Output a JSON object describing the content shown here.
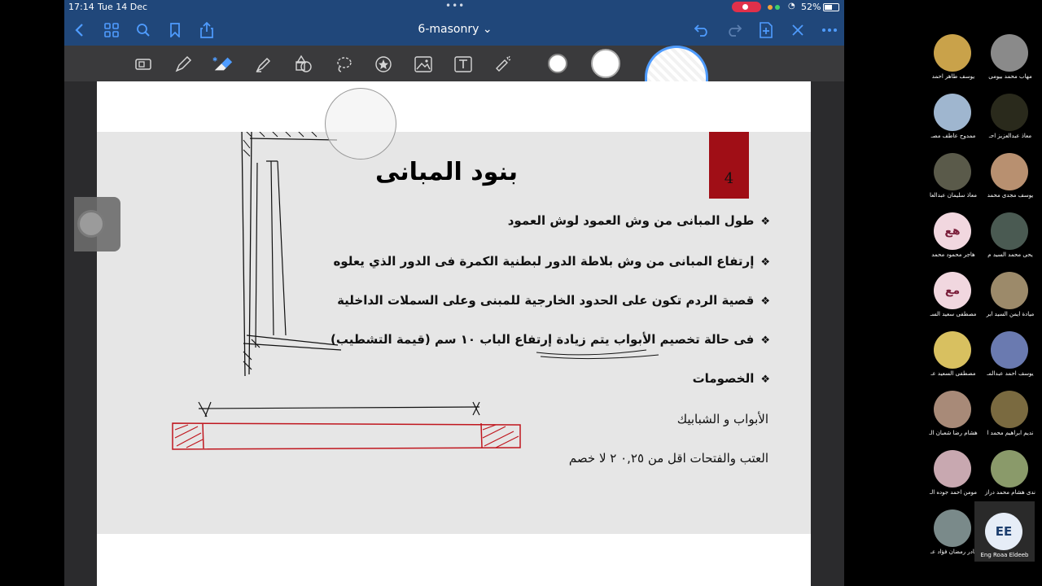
{
  "statusbar": {
    "time": "17:14",
    "date": "Tue 14 Dec",
    "multitask": "•••",
    "battery": "52%"
  },
  "navbar": {
    "title": "6-masonry ⌄",
    "back_icon": "chevron-left-icon",
    "grid_icon": "thumbnails-icon",
    "search_icon": "search-icon",
    "bookmark_icon": "bookmark-icon",
    "share_icon": "share-icon",
    "undo_icon": "undo-icon",
    "redo_icon": "redo-icon",
    "add_page_icon": "add-page-icon",
    "close_icon": "close-icon",
    "more_icon": "more-icon"
  },
  "toolbar": {
    "tools": [
      "zoom-window-icon",
      "pen-icon",
      "eraser-icon",
      "highlighter-icon",
      "shapes-icon",
      "lasso-icon",
      "sticker-icon",
      "image-icon",
      "text-icon",
      "laser-pointer-icon"
    ],
    "swatches": [
      "size-small",
      "size-medium",
      "size-large"
    ]
  },
  "slide": {
    "number": "4",
    "title": "بنود المبانى",
    "bullets": [
      "طول المبانى من وش العمود لوش العمود",
      "إرتفاع المبانى من وش بلاطة الدور لبطنية الكمرة فى الدور الذي يعلوه",
      "قصية الردم تكون على الحدود الخارجية للمبنى وعلى السملات الداخلية",
      "فى حالة تخصيم الأبواب يتم زيادة إرتفاع الباب ١٠ سم (قيمة التشطيب)",
      "الخصومات"
    ],
    "plain_lines": [
      "الأبواب و الشبابيك",
      "العتب والفتحات اقل من ٠,٢٥ ٢ لا خصم"
    ],
    "bullet_mark": "❖"
  },
  "participants": [
    {
      "name": "يوسف طاهر احمد",
      "color": "#c9a24a"
    },
    {
      "name": "مهاب محمد بيومى",
      "color": "#8a8a8a"
    },
    {
      "name": "ممدوح عاطف مصـ",
      "color": "#9fb6cf"
    },
    {
      "name": "معاذ عبدالعزيز احـ",
      "color": "#2a2a1c"
    },
    {
      "name": "معاذ سليمان عبدالعا",
      "color": "#5a5a4a"
    },
    {
      "name": "يوسف مجدى محمد",
      "color": "#b89070"
    },
    {
      "name": "هاجر محمود محمد",
      "initials": "هع"
    },
    {
      "name": "يحى محمد السيد م",
      "color": "#4a5a52"
    },
    {
      "name": "مصطفى سعيد السـ",
      "initials": "مع"
    },
    {
      "name": "ميادة ايمن السيد ابر",
      "color": "#9c8a6a"
    },
    {
      "name": "مصطفى السعيد عـ",
      "color": "#d8c060"
    },
    {
      "name": "يوسف احمد عبدالمـ",
      "color": "#6a7ab0"
    },
    {
      "name": "هشام رضا شعبان الـ",
      "color": "#a88a78"
    },
    {
      "name": "نديم ابراهيم محمد ا",
      "color": "#7a6a40"
    },
    {
      "name": "مومن احمد جوده الـ",
      "color": "#c8a8b0"
    },
    {
      "name": "ندى هشام محمد دراز",
      "color": "#8a9a6a"
    },
    {
      "name": "نادر رمضان فؤاد عـ",
      "color": "#7a8a8a"
    }
  ],
  "self": {
    "initials": "EE",
    "name": "Eng Roaa Eldeeb"
  },
  "colors": {
    "nav_bg": "#20477a",
    "accent": "#4f9cff",
    "slide_number_bg": "#a00e16",
    "ink_red": "#c0161e"
  }
}
